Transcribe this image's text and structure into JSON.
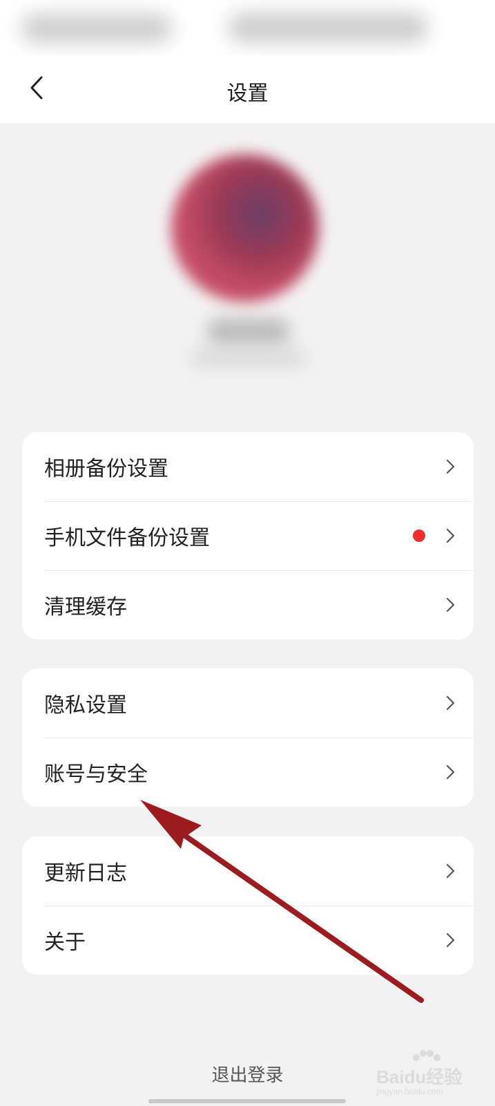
{
  "header": {
    "title": "设置"
  },
  "cards": [
    {
      "items": [
        {
          "label": "相册备份设置",
          "badge": false
        },
        {
          "label": "手机文件备份设置",
          "badge": true
        },
        {
          "label": "清理缓存",
          "badge": false
        }
      ]
    },
    {
      "items": [
        {
          "label": "隐私设置",
          "badge": false
        },
        {
          "label": "账号与安全",
          "badge": false
        }
      ]
    },
    {
      "items": [
        {
          "label": "更新日志",
          "badge": false
        },
        {
          "label": "关于",
          "badge": false
        }
      ]
    }
  ],
  "footer": {
    "logout_label": "退出登录"
  },
  "watermark": {
    "brand": "Baidu经验",
    "url": "jingyan.baidu.com"
  },
  "colors": {
    "badge": "#f22c2c",
    "annotation_arrow": "#9b1b1f"
  }
}
